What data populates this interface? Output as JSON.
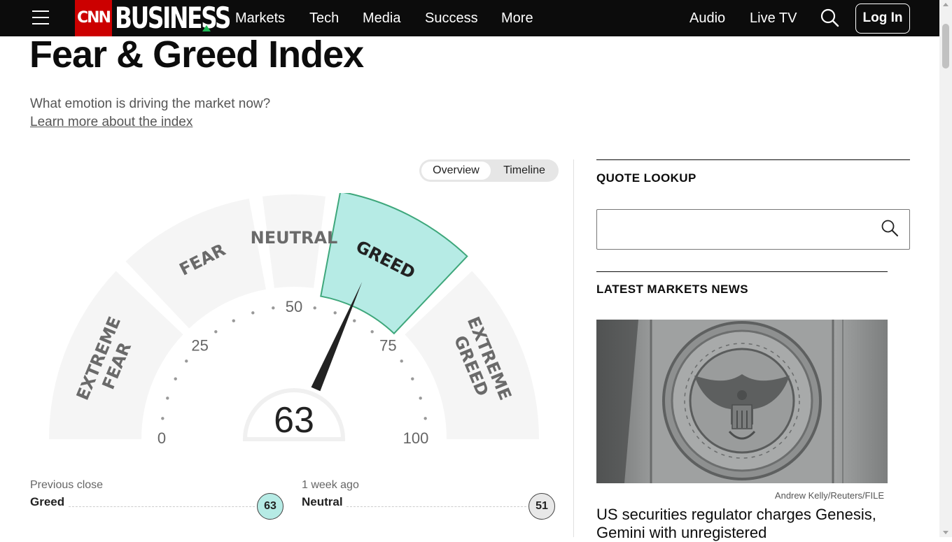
{
  "nav": {
    "logo_cnn": "CNN",
    "logo_business": "BUSINESS",
    "links": [
      "Markets",
      "Tech",
      "Media",
      "Success",
      "More"
    ],
    "right_links": [
      "Audio",
      "Live TV"
    ],
    "login_label": "Log In"
  },
  "page": {
    "title": "Fear & Greed Index",
    "subtitle": "What emotion is driving the market now?",
    "learn_more": "Learn more about the index"
  },
  "toggle": {
    "options": [
      "Overview",
      "Timeline"
    ],
    "active": "Overview"
  },
  "gauge": {
    "value": 63,
    "active_segment": "GREED",
    "segments": [
      {
        "label": "EXTREME FEAR",
        "from": 0,
        "to": 25
      },
      {
        "label": "FEAR",
        "from": 25,
        "to": 45
      },
      {
        "label": "NEUTRAL",
        "from": 45,
        "to": 55
      },
      {
        "label": "GREED",
        "from": 55,
        "to": 75
      },
      {
        "label": "EXTREME GREED",
        "from": 75,
        "to": 100
      }
    ],
    "ticks": [
      "0",
      "25",
      "50",
      "75",
      "100"
    ],
    "colors": {
      "segment": "#f5f5f5",
      "active_fill": "#b6ebe5",
      "active_stroke": "#3ea77b",
      "needle": "#222222",
      "tick_text": "#666666"
    }
  },
  "readings": [
    {
      "label": "Previous close",
      "value": "Greed",
      "score": "63",
      "color": "#b6ebe5"
    },
    {
      "label": "1 week ago",
      "value": "Neutral",
      "score": "51",
      "color": "#e8e8e8"
    }
  ],
  "sidebar": {
    "quote_lookup": "QUOTE LOOKUP",
    "quote_input_value": "",
    "latest_news": "LATEST MARKETS NEWS",
    "image_icon": "sec-seal-image",
    "image_credit": "Andrew Kelly/Reuters/FILE",
    "headline": "US securities regulator charges Genesis, Gemini with unregistered"
  }
}
